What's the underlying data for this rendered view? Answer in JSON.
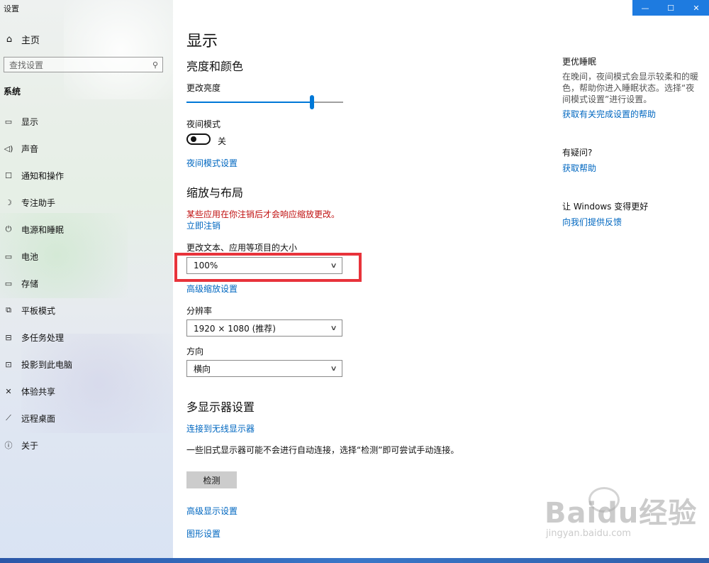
{
  "window": {
    "title": "设置"
  },
  "window_controls": {
    "minimize": "—",
    "maximize": "☐",
    "close": "✕"
  },
  "sidebar": {
    "home": {
      "icon": "home-icon",
      "label": "主页"
    },
    "search": {
      "placeholder": "查找设置",
      "icon": "search-icon"
    },
    "section": "系统",
    "items": [
      {
        "icon": "monitor-icon",
        "label": "显示"
      },
      {
        "icon": "speaker-icon",
        "label": "声音"
      },
      {
        "icon": "notification-icon",
        "label": "通知和操作"
      },
      {
        "icon": "moon-icon",
        "label": "专注助手"
      },
      {
        "icon": "power-icon",
        "label": "电源和睡眠"
      },
      {
        "icon": "battery-icon",
        "label": "电池"
      },
      {
        "icon": "storage-icon",
        "label": "存储"
      },
      {
        "icon": "tablet-icon",
        "label": "平板模式"
      },
      {
        "icon": "multitask-icon",
        "label": "多任务处理"
      },
      {
        "icon": "project-icon",
        "label": "投影到此电脑"
      },
      {
        "icon": "share-icon",
        "label": "体验共享"
      },
      {
        "icon": "remote-desktop-icon",
        "label": "远程桌面"
      },
      {
        "icon": "info-icon",
        "label": "关于"
      }
    ]
  },
  "main": {
    "title": "显示",
    "brightness": {
      "heading": "亮度和颜色",
      "label": "更改亮度",
      "value": 0.8,
      "night_mode_label": "夜间模式",
      "night_mode_state": "关",
      "night_mode_on": false,
      "night_mode_link": "夜间模式设置"
    },
    "scale": {
      "heading": "缩放与布局",
      "warning": "某些应用在你注销后才会响应缩放更改。",
      "signout_link": "立即注销",
      "size_label": "更改文本、应用等项目的大小",
      "size_value": "100%",
      "advanced_link": "高级缩放设置",
      "resolution_label": "分辨率",
      "resolution_value": "1920 × 1080 (推荐)",
      "orientation_label": "方向",
      "orientation_value": "横向"
    },
    "multi": {
      "heading": "多显示器设置",
      "wireless_link": "连接到无线显示器",
      "description": "一些旧式显示器可能不会进行自动连接，选择“检测”即可尝试手动连接。",
      "detect_button": "检测",
      "advanced_display_link": "高级显示设置",
      "graphics_link": "图形设置"
    }
  },
  "right": {
    "sleep_heading": "更优睡眠",
    "sleep_text": "在晚间，夜间模式会显示较柔和的暖色，帮助你进入睡眠状态。选择“夜间模式设置”进行设置。",
    "sleep_link": "获取有关完成设置的帮助",
    "question_heading": "有疑问?",
    "help_link": "获取帮助",
    "improve_heading": "让 Windows 变得更好",
    "feedback_link": "向我们提供反馈"
  },
  "watermark": {
    "main": "Baidu经验",
    "sub": "jingyan.baidu.com"
  },
  "colors": {
    "accent": "#0078d7",
    "link": "#0067c0",
    "warning": "#c01010",
    "highlight_box": "#e8333b"
  }
}
